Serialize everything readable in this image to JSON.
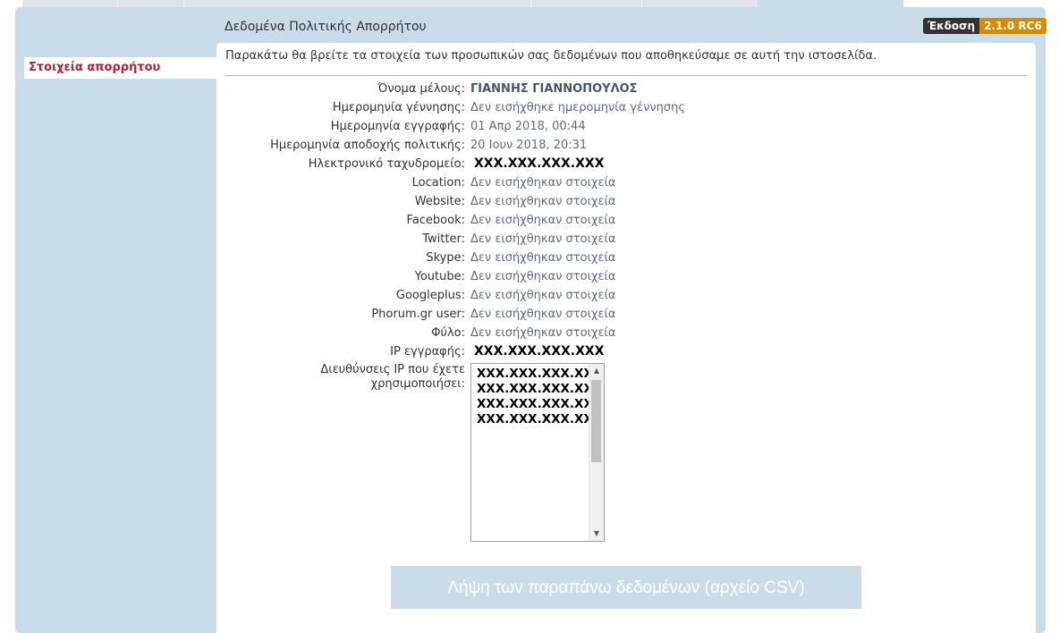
{
  "page": {
    "title": "Δεδομένα Πολιτικής Απορρήτου",
    "version_label": "Έκδοση",
    "version_value": "2.1.0 RC6",
    "intro": "Παρακάτω θα βρείτε τα στοιχεία των προσωπικών σας δεδομένων που αποθηκεύσαμε σε αυτή την ιστοσελίδα."
  },
  "sidebar": {
    "items": [
      {
        "label": "Στοιχεία απορρήτου"
      }
    ]
  },
  "fields": [
    {
      "label": "Όνομα μέλους:",
      "value": "ΓΙΑΝΝΗΣ ΓΙΑΝΝΟΠΟΥΛΟΣ"
    },
    {
      "label": "Ημερομηνία γέννησης:",
      "value": "Δεν εισήχθηκε ημερομηνία γέννησης"
    },
    {
      "label": "Ημερομηνία εγγραφής:",
      "value": "01 Απρ 2018, 00:44"
    },
    {
      "label": "Ημερομηνία αποδοχής πολιτικής:",
      "value": "20 Ιουν 2018, 20:31"
    },
    {
      "label": "Ηλεκτρονικό ταχυδρομείο:",
      "value": "XXX.XXX.XXX.XXX"
    },
    {
      "label": "Location:",
      "value": "Δεν εισήχθηκαν στοιχεία"
    },
    {
      "label": "Website:",
      "value": "Δεν εισήχθηκαν στοιχεία"
    },
    {
      "label": "Facebook:",
      "value": "Δεν εισήχθηκαν στοιχεία"
    },
    {
      "label": "Twitter:",
      "value": "Δεν εισήχθηκαν στοιχεία"
    },
    {
      "label": "Skype:",
      "value": "Δεν εισήχθηκαν στοιχεία"
    },
    {
      "label": "Youtube:",
      "value": "Δεν εισήχθηκαν στοιχεία"
    },
    {
      "label": "Googleplus:",
      "value": "Δεν εισήχθηκαν στοιχεία"
    },
    {
      "label": "Phorum.gr user:",
      "value": "Δεν εισήχθηκαν στοιχεία"
    },
    {
      "label": "Φύλο:",
      "value": "Δεν εισήχθηκαν στοιχεία"
    },
    {
      "label": "IP εγγραφής:",
      "value": "XXX.XXX.XXX.XXX"
    }
  ],
  "ip_addresses": {
    "label": "Διευθύνσεις IP που έχετε χρησιμοποιήσει:",
    "values": [
      "XXX.XXX.XXX.XXX",
      "XXX.XXX.XXX.XXX",
      "XXX.XXX.XXX.XXX",
      "XXX.XXX.XXX.XXX"
    ]
  },
  "download_button": "Λήψη των παραπάνω δεδομένων (αρχείο CSV)",
  "icons": {
    "scroll_up": "scroll-up-arrow-icon",
    "scroll_down": "scroll-down-arrow-icon"
  }
}
